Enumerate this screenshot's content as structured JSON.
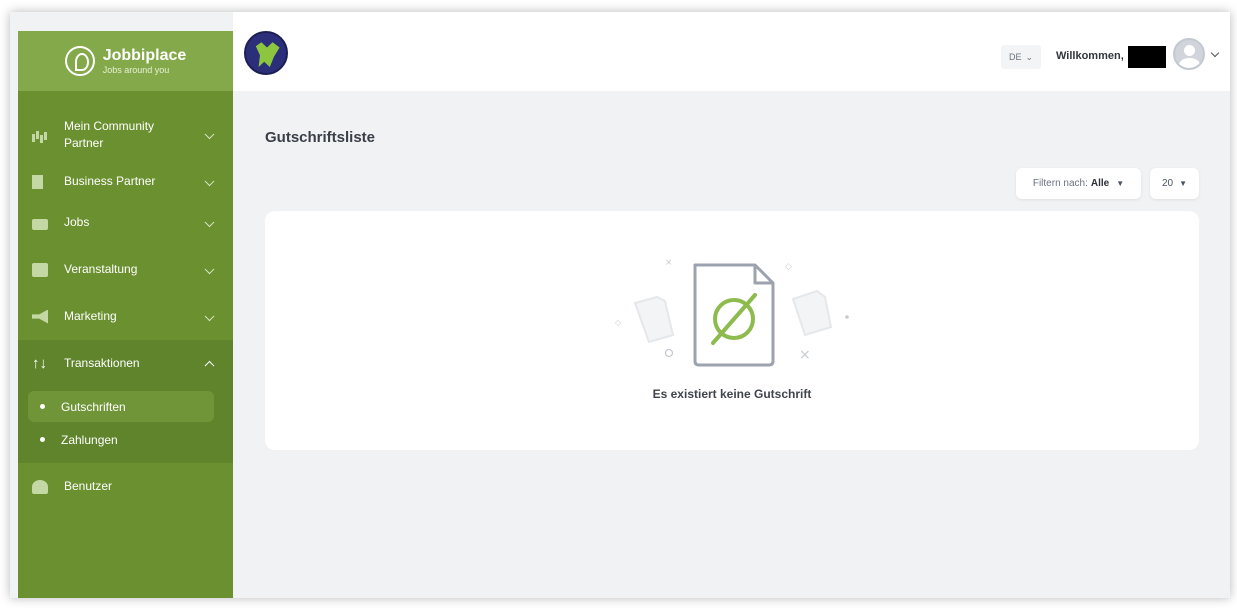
{
  "brand": {
    "name": "Jobbiplace",
    "tagline": "Jobs around you"
  },
  "header": {
    "language": "DE",
    "welcome": "Willkommen,"
  },
  "sidebar": {
    "items": [
      {
        "label": "Mein Community Partner",
        "icon": "chart-icon"
      },
      {
        "label": "Business Partner",
        "icon": "building-icon"
      },
      {
        "label": "Jobs",
        "icon": "briefcase-icon"
      },
      {
        "label": "Veranstaltung",
        "icon": "calendar-icon"
      },
      {
        "label": "Marketing",
        "icon": "megaphone-icon"
      },
      {
        "label": "Transaktionen",
        "icon": "arrows-updown-icon",
        "expanded": true
      },
      {
        "label": "Benutzer",
        "icon": "users-icon"
      }
    ],
    "subitems": [
      {
        "label": "Gutschriften",
        "active": true
      },
      {
        "label": "Zahlungen",
        "active": false
      }
    ]
  },
  "main": {
    "title": "Gutschriftsliste",
    "filter_label": "Filtern nach:",
    "filter_value": "Alle",
    "page_size": "20",
    "empty_message": "Es existiert keine Gutschrift"
  },
  "colors": {
    "sidebar": "#6b9030",
    "brand_bar": "#84a94a",
    "accent": "#8dbb4d",
    "background": "#f1f2f4"
  }
}
